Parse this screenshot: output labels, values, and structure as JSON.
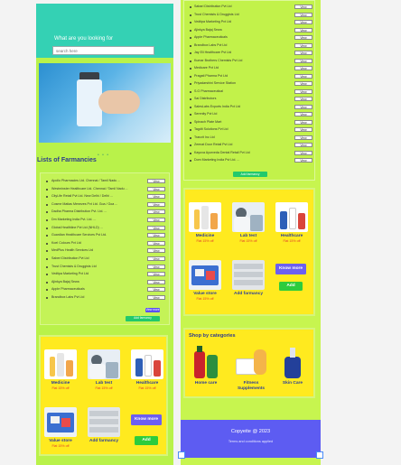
{
  "hero": {
    "question": "What are you looking for",
    "search_placeholder": "search here",
    "carousel_dots": "• • •"
  },
  "list_title": "Lists of Farmancies",
  "left_list": [
    "Apollo Pharmacies Ltd. Chennai / Tamil Nadu ...",
    "Westminster Healthcare Ltd. Chennai / Tamil Nadu ...",
    "CityLife Retail Pvt Ltd. New Delhi / Delhi ...",
    "Cosme Matias Menezes Pvt Ltd. Goa / Goa ...",
    "Dadha Pharma Distribution Pvt. Ltd. ...",
    "Dm Marketing India Pvt. Ltd. ...",
    "Global Healthline Pvt Ltd (NHLD) ...",
    "Guardian Healthcare Services Pvt Ltd.",
    "Koel Colours Pvt Ltd",
    "MedPlus Health Services Ltd",
    "Saberi Distribution Pvt Ltd",
    "Trust Chemists & Druggists Ltd",
    "Vedtipa Marketing Pvt Ltd",
    "Ajinkya Bajaj Sewa",
    "Apple Pharmaceuticals",
    "Brandbox Labs Pvt Ltd"
  ],
  "view_label": "View",
  "view_more_label": "View more",
  "add_farmancy_label": "Add farmancy",
  "categories": [
    {
      "name": "Medicine",
      "offer": "Flat 15% off"
    },
    {
      "name": "Lab test",
      "offer": "Flat 15% off"
    },
    {
      "name": "Healthcare",
      "offer": "Flat 15% off"
    },
    {
      "name": "Value store",
      "offer": "Flat 15% off"
    },
    {
      "name": "Add farmancy",
      "offer": ""
    }
  ],
  "know_more_label": "Know more",
  "add_label": "Add",
  "middle_list": [
    "Sabari Distribution Pvt Ltd",
    "Trust Chemists & Druggists Ltd",
    "Vedtipa Marketing Pvt Ltd",
    "Ajinkya Bajaj Sewa",
    "Apple Pharmaceuticals",
    "Brandbox Labs Pvt Ltd",
    "Jay Eli Healthcare Pvt Ltd",
    "Kumar Brothers Chemists Pvt Ltd",
    "Medicare Pvt Ltd",
    "Pragati Pharma Pvt Ltd",
    "Priyadarshini Service Station",
    "S.G Pharmaceutical",
    "Sai Distributors",
    "SalesLabs Exports India Pvt Ltd",
    "Serenity Pvt Ltd",
    "Spinach Plate Mart",
    "Tagdit Solutions Pvt Ltd",
    "Tranzit Inc Ltd",
    "Zeenat Door Retail Pvt Ltd",
    "Kayuva Ayurveda Dental Retail Pvt Ltd",
    "Dom Marketing India Pvt Ltd. ..."
  ],
  "middle_categories": [
    {
      "name": "Medicine",
      "offer": "Flat 15% off"
    },
    {
      "name": "Lab test",
      "offer": "Flat 15% off"
    },
    {
      "name": "Healthcare",
      "offer": "Flat 15% off"
    },
    {
      "name": "Value store",
      "offer": "Flat 15% off"
    },
    {
      "name": "Add farmancy",
      "offer": ""
    }
  ],
  "shop": {
    "title": "Shop by categories",
    "items": [
      {
        "name": "Home care"
      },
      {
        "name": "Fitness Supplements"
      },
      {
        "name": "Skin Care"
      }
    ]
  },
  "footer": {
    "copyright": "Copyeite @ 2023",
    "terms": "Terms and conditions applied"
  },
  "colors": {
    "teal": "#34d1b4",
    "lime": "#b9f24a",
    "yellow": "#ffea1f",
    "purple": "#5d5cf2",
    "green": "#22c96c"
  }
}
